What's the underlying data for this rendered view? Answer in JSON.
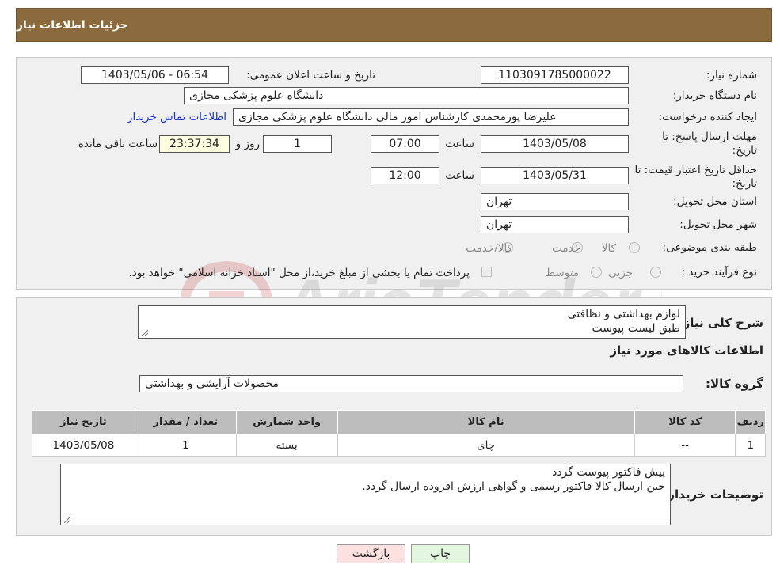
{
  "header": {
    "title": "جزئیات اطلاعات نیاز"
  },
  "info": {
    "need_number_label": "شماره نیاز:",
    "need_number": "1103091785000022",
    "announce_label": "تاریخ و ساعت اعلان عمومی:",
    "announce_value": "1403/05/06 - 06:54",
    "buyer_label": "نام دستگاه خریدار:",
    "buyer_value": "دانشگاه علوم پزشکی مجازی",
    "creator_label": "ایجاد کننده درخواست:",
    "creator_value": "علیرضا پورمحمدی کارشناس امور مالی دانشگاه علوم پزشکی مجازی",
    "contact_link": "اطلاعات تماس خریدار",
    "deadline_label": "مهلت ارسال پاسخ: تا تاریخ:",
    "deadline_date": "1403/05/08",
    "time_label": "ساعت",
    "deadline_time": "07:00",
    "days_value": "1",
    "days_label": "روز و",
    "remaining_value": "23:37:34",
    "remaining_label": "ساعت باقی مانده",
    "validity_label": "حداقل تاریخ اعتبار قیمت: تا تاریخ:",
    "validity_date": "1403/05/31",
    "validity_time": "12:00",
    "province_label": "استان محل تحویل:",
    "province_value": "تهران",
    "city_label": "شهر محل تحویل:",
    "city_value": "تهران",
    "category_label": "طبقه بندی موضوعی:",
    "category_options": [
      "کالا",
      "خدمت",
      "کالا/خدمت"
    ],
    "process_label": "نوع فرآیند خرید :",
    "process_options": [
      "جزیی",
      "متوسط"
    ],
    "process_note": "پرداخت تمام یا بخشی از مبلغ خرید،از محل \"اسناد خزانه اسلامی\" خواهد بود."
  },
  "watermark": {
    "text": "AriaTender.neT"
  },
  "details": {
    "summary_label": "شرح کلی نیاز:",
    "summary_lines": [
      "لوازم بهداشتی و نظافتی",
      "طبق لیست پیوست"
    ],
    "goods_info_title": "اطلاعات کالاهای مورد نیاز",
    "group_label": "گروه کالا:",
    "group_value": "محصولات آرایشی و بهداشتی",
    "table": {
      "headers": [
        "ردیف",
        "کد کالا",
        "نام کالا",
        "واحد شمارش",
        "تعداد / مقدار",
        "تاریخ نیاز"
      ],
      "rows": [
        [
          "1",
          "--",
          "چای",
          "بسته",
          "1",
          "1403/05/08"
        ]
      ]
    },
    "buyer_notes_label": "توضیحات خریدار:",
    "buyer_notes_lines": [
      "پیش فاکتور پیوست گردد",
      "حین ارسال کالا فاکتور رسمی و گواهی ارزش افزوده ارسال گردد."
    ]
  },
  "buttons": {
    "back": "بازگشت",
    "print": "چاپ"
  }
}
